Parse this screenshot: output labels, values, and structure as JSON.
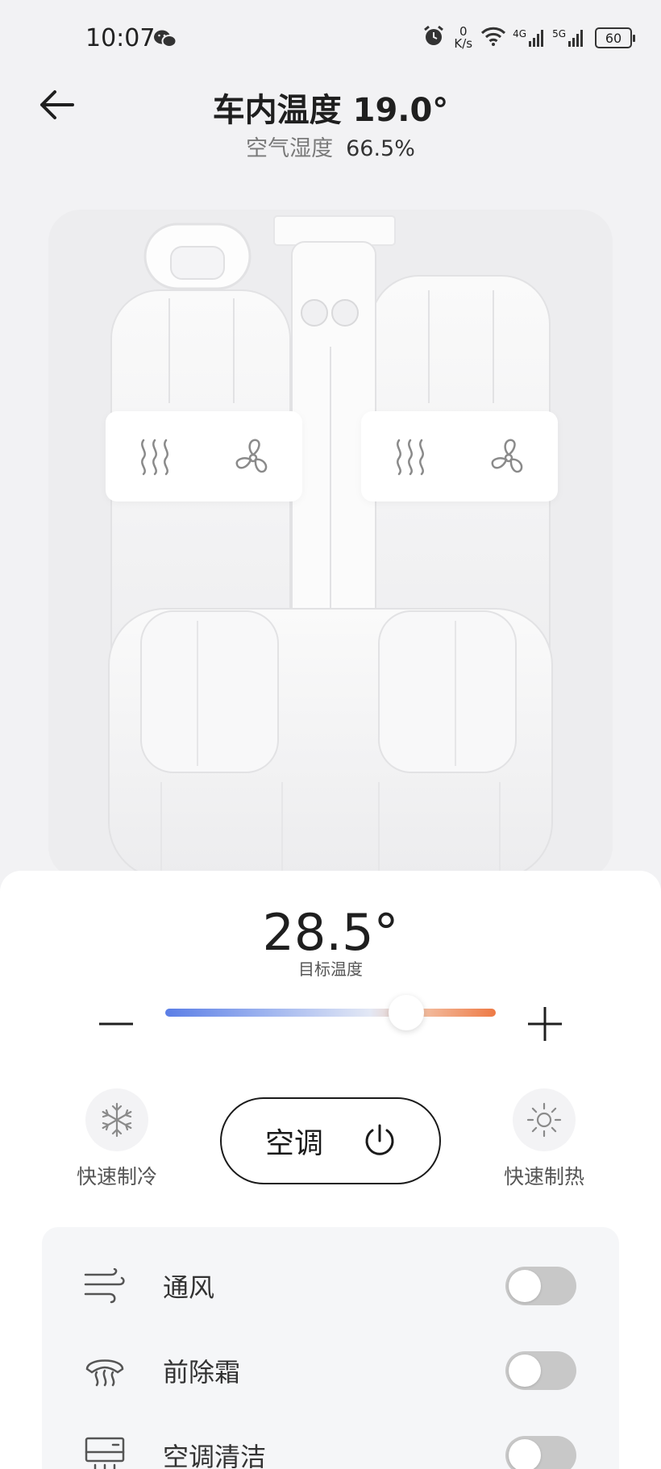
{
  "status_bar": {
    "time": "10:07",
    "net_speed_value": "0",
    "net_speed_unit": "K/s",
    "network_1": "4G",
    "network_2": "5G",
    "battery": "60"
  },
  "header": {
    "title": "车内温度 19.0°",
    "humidity_label": "空气湿度",
    "humidity_value": "66.5%"
  },
  "seat_controls": {
    "left": [
      "seat-heat-icon",
      "fan-icon"
    ],
    "right": [
      "seat-heat-icon",
      "fan-icon"
    ]
  },
  "climate": {
    "target_temp": "28.5°",
    "target_label": "目标温度",
    "slider_level": 0.73,
    "quick_cool_label": "快速制冷",
    "quick_heat_label": "快速制热",
    "ac_label": "空调"
  },
  "options": [
    {
      "icon": "wind-icon",
      "label": "通风",
      "enabled": false
    },
    {
      "icon": "defrost-icon",
      "label": "前除霜",
      "enabled": false
    },
    {
      "icon": "ac-clean-icon",
      "label": "空调清洁",
      "enabled": false
    }
  ],
  "colors": {
    "slider_cold": "#5b7ee6",
    "slider_hot": "#ee7a45",
    "toggle_off": "#c8c8c8"
  }
}
